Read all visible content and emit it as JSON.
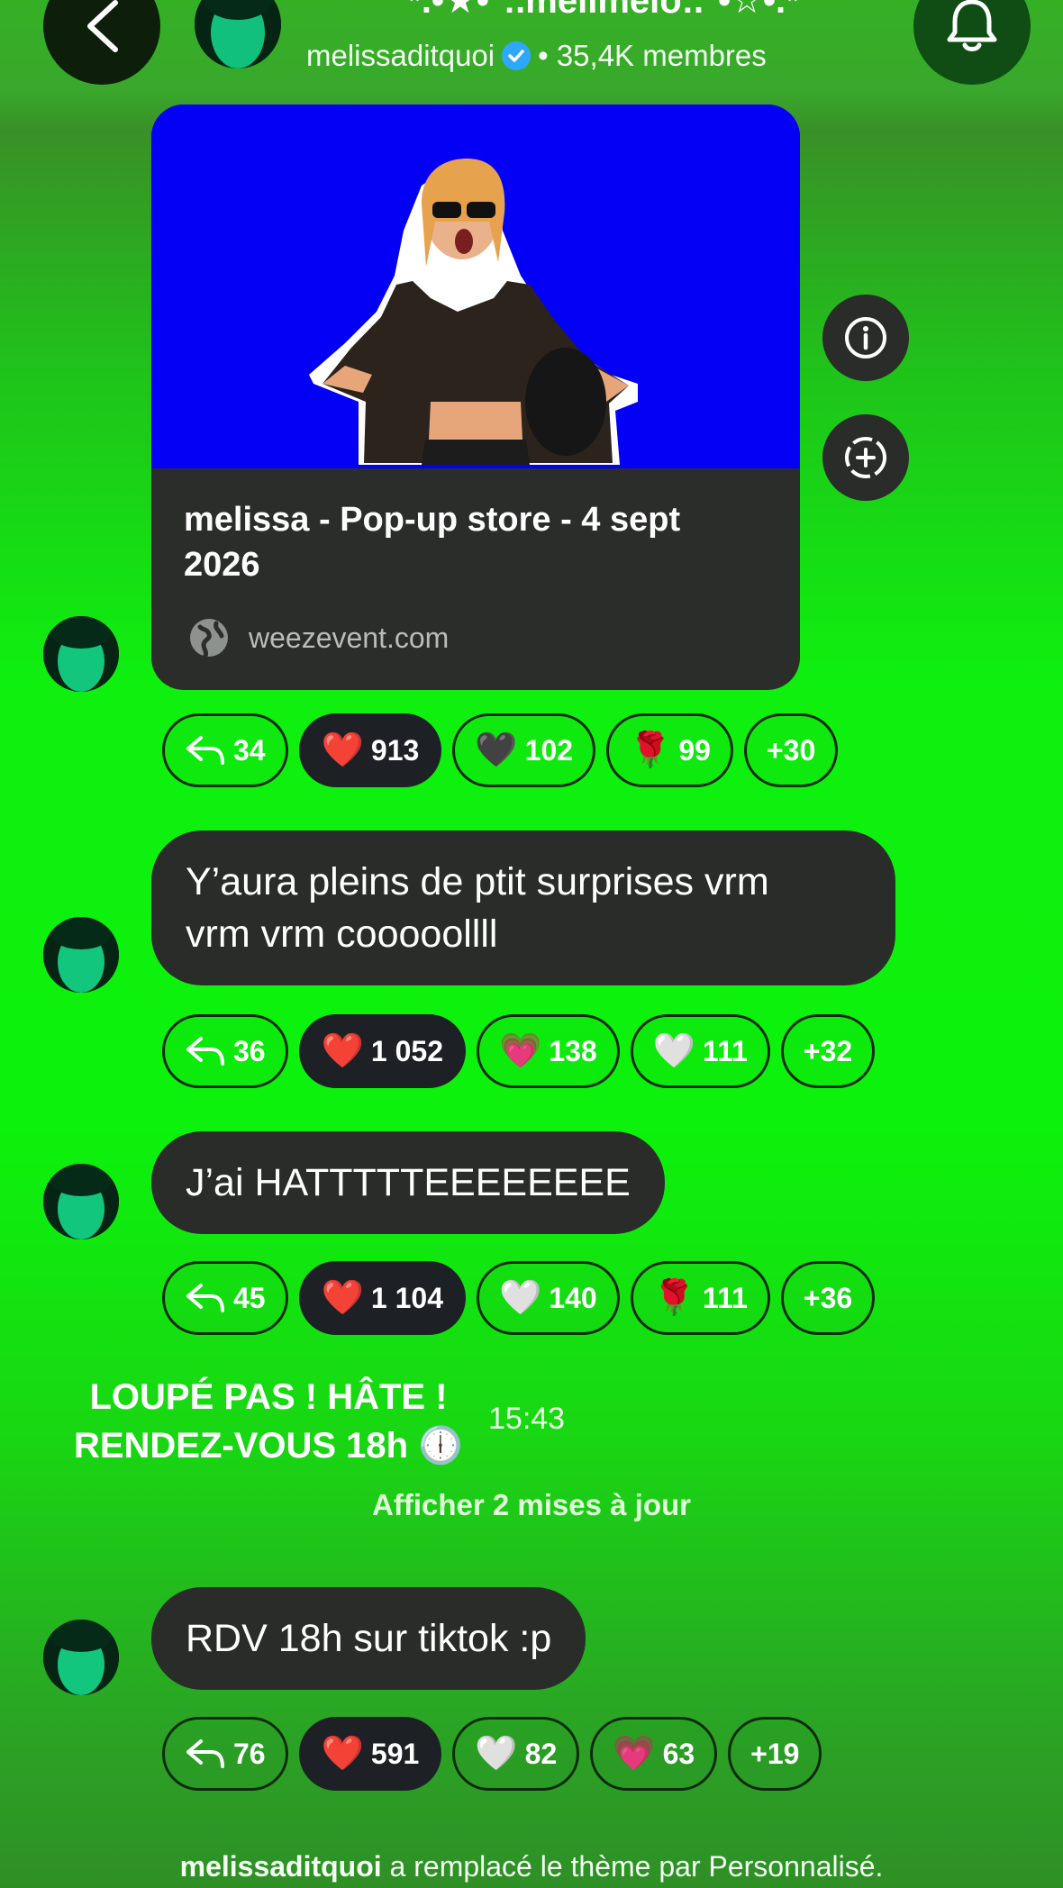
{
  "header": {
    "title": "*.•★•°:.melimelo:.°•☆•.*",
    "owner": "melissaditquoi",
    "members": "• 35,4K membres",
    "back_icon": "chevron-left-icon",
    "bell_icon": "bell-icon"
  },
  "link_card": {
    "title": "melissa - Pop-up store - 4 sept 2026",
    "domain": "weezevent.com",
    "image_bg": "#0400f5"
  },
  "messages": [
    {
      "text_lines": [],
      "reactions": [
        {
          "emoji": "↩",
          "count": "34"
        },
        {
          "emoji": "❤️",
          "count": "913"
        },
        {
          "emoji": "🖤",
          "count": "102"
        },
        {
          "emoji": "🌹",
          "count": "99"
        },
        {
          "emoji": "",
          "count": "+30"
        }
      ]
    },
    {
      "text_lines": [
        "Y’aura pleins de ptit surprises vrm",
        "vrm vrm cooooollll"
      ],
      "reactions": [
        {
          "emoji": "↩",
          "count": "36"
        },
        {
          "emoji": "❤️",
          "count": "1 052"
        },
        {
          "emoji": "💗",
          "count": "138"
        },
        {
          "emoji": "🤍",
          "count": "111"
        },
        {
          "emoji": "",
          "count": "+32"
        }
      ]
    },
    {
      "text_lines": [
        "J’ai HATTTTTEEEEEEEE"
      ],
      "reactions": [
        {
          "emoji": "↩",
          "count": "45"
        },
        {
          "emoji": "❤️",
          "count": "1 104"
        },
        {
          "emoji": "🤍",
          "count": "140"
        },
        {
          "emoji": "🌹",
          "count": "111"
        },
        {
          "emoji": "",
          "count": "+36"
        }
      ]
    },
    {
      "text_lines": [
        "RDV 18h sur tiktok :p"
      ],
      "reactions": [
        {
          "emoji": "↩",
          "count": "76"
        },
        {
          "emoji": "❤️",
          "count": "591"
        },
        {
          "emoji": "🤍",
          "count": "82"
        },
        {
          "emoji": "💗",
          "count": "63"
        },
        {
          "emoji": "",
          "count": "+19"
        }
      ]
    }
  ],
  "announcement": {
    "line1": "LOUPÉ PAS ! HÂTE !",
    "line2": "RENDEZ-VOUS 18h",
    "clock_emoji": "🕕",
    "time": "15:43"
  },
  "show_updates": "Afficher 2 mises à jour",
  "footer": {
    "user": "melissaditquoi",
    "text": "a remplacé le thème par Personnalisé."
  },
  "colors": {
    "bubble": "#2a2c29",
    "chip_dark": "#1d2126",
    "accent_green": "#0cf20c",
    "verified_blue": "#2ea8ff"
  }
}
